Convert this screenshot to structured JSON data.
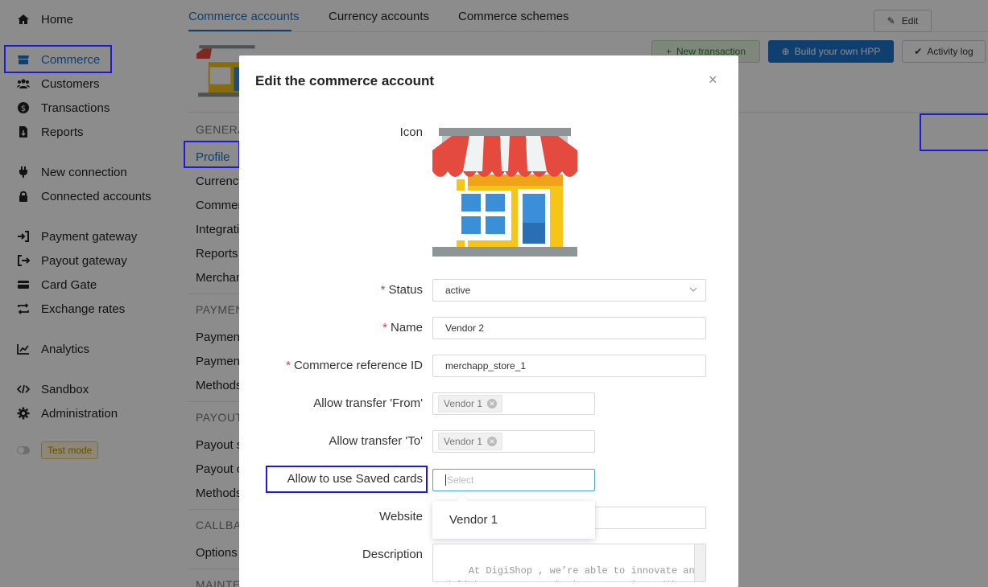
{
  "sidebar": {
    "items": [
      {
        "label": "Home",
        "icon": "home-icon"
      },
      {
        "label": "Commerce",
        "icon": "store-icon"
      },
      {
        "label": "Customers",
        "icon": "users-icon"
      },
      {
        "label": "Transactions",
        "icon": "dollar-icon"
      },
      {
        "label": "Reports",
        "icon": "report-icon"
      },
      {
        "label": "New connection",
        "icon": "plug-icon"
      },
      {
        "label": "Connected accounts",
        "icon": "lock-icon"
      },
      {
        "label": "Payment gateway",
        "icon": "sign-in-icon"
      },
      {
        "label": "Payout gateway",
        "icon": "sign-out-icon"
      },
      {
        "label": "Card Gate",
        "icon": "card-icon"
      },
      {
        "label": "Exchange rates",
        "icon": "exchange-icon"
      },
      {
        "label": "Analytics",
        "icon": "chart-icon"
      },
      {
        "label": "Sandbox",
        "icon": "code-icon"
      },
      {
        "label": "Administration",
        "icon": "gear-icon"
      }
    ],
    "test_mode": "Test mode"
  },
  "tabs": [
    "Commerce accounts",
    "Currency accounts",
    "Commerce schemes"
  ],
  "header": {
    "new_transaction": "New transaction",
    "build_hpp": "Build your own HPP",
    "activity_log": "Activity log"
  },
  "left_panel": {
    "sections": [
      {
        "title": "GENERA",
        "items": [
          "Profile",
          "Currency",
          "Commer",
          "Integrati",
          "Reports",
          "Merchan"
        ]
      },
      {
        "title": "PAYMEN",
        "items": [
          "Payment",
          "Payment",
          "Methods"
        ]
      },
      {
        "title": "PAYOUT",
        "items": [
          "Payout s",
          "Payout c",
          "Methods"
        ]
      },
      {
        "title": "CALLBAC",
        "items": [
          "Options"
        ]
      },
      {
        "title": "MAINTE",
        "items": []
      }
    ]
  },
  "edit_button": "Edit",
  "modal": {
    "title": "Edit the commerce account",
    "close": "×",
    "fields": {
      "icon_label": "Icon",
      "status_label": "Status",
      "status_value": "active",
      "name_label": "Name",
      "name_value": "Vendor 2",
      "ref_label": "Commerce reference ID",
      "ref_value": "merchapp_store_1",
      "from_label": "Allow transfer 'From'",
      "from_tag": "Vendor 1",
      "to_label": "Allow transfer 'To'",
      "to_tag": "Vendor 1",
      "saved_cards_label": "Allow to use Saved cards",
      "saved_cards_placeholder": "Select",
      "dropdown_option": "Vendor 1",
      "website_label": "Website",
      "description_label": "Description",
      "description_value": "At DigiShop , we’re able to innovate and\ndelight customers thanks to our incredib\nle and ..."
    }
  },
  "colors": {
    "accent": "#1a73c8",
    "highlight": "#1b1bd8",
    "required": "#e53935"
  }
}
